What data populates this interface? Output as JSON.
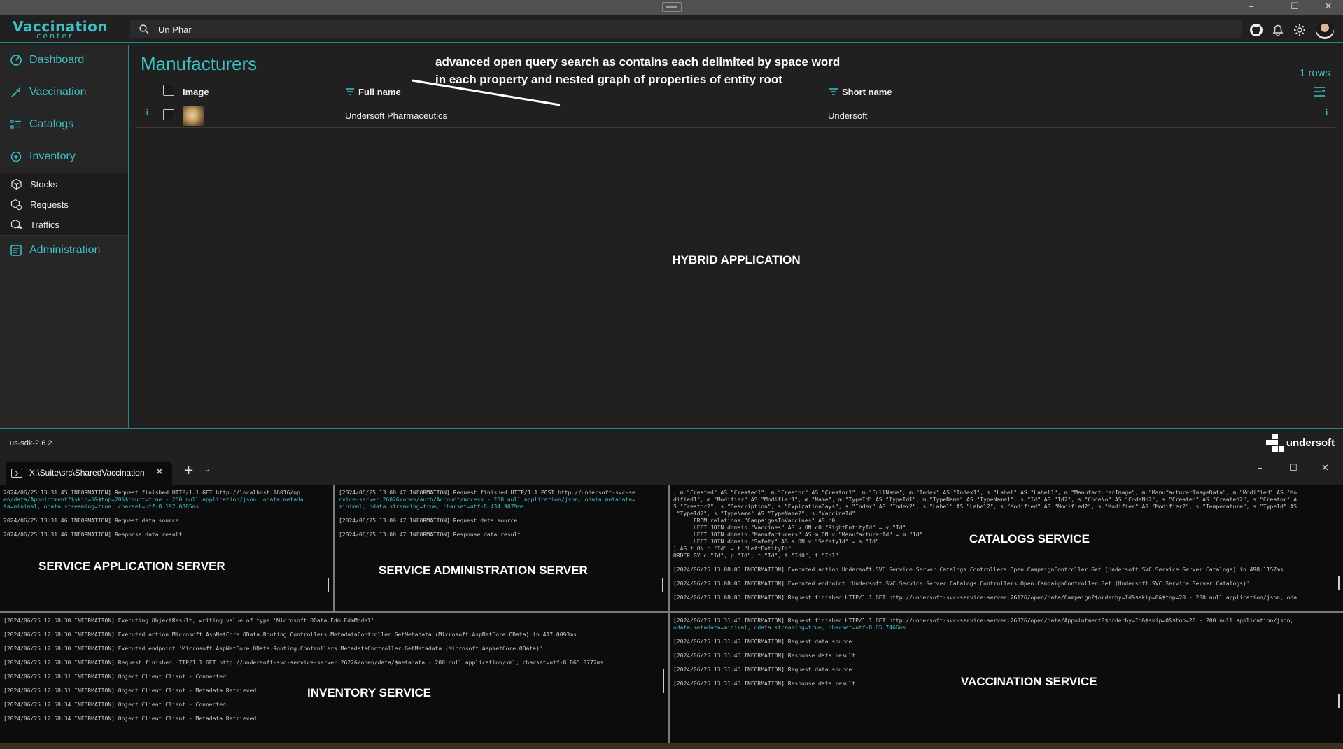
{
  "app": {
    "logo_line1": "Vaccination",
    "logo_line2": "center",
    "search_value": "Un Phar",
    "window_controls": [
      "–",
      "☐",
      "✕"
    ],
    "header_icons": [
      "github-icon",
      "bell-icon",
      "gear-icon",
      "avatar"
    ]
  },
  "sidebar": {
    "items": [
      {
        "label": "Dashboard",
        "icon": "dashboard-icon"
      },
      {
        "label": "Vaccination",
        "icon": "syringe-icon"
      },
      {
        "label": "Catalogs",
        "icon": "catalog-icon"
      },
      {
        "label": "Inventory",
        "icon": "inventory-icon"
      }
    ],
    "sub_items": [
      {
        "label": "Stocks",
        "icon": "box-icon"
      },
      {
        "label": "Requests",
        "icon": "request-icon"
      },
      {
        "label": "Traffics",
        "icon": "traffic-icon"
      }
    ],
    "admin": {
      "label": "Administration",
      "icon": "admin-icon"
    },
    "more": "..."
  },
  "main": {
    "title": "Manufacturers",
    "annotation_line1": "advanced open query search as contains each delimited by space word",
    "annotation_line2": "in each property and nested graph of properties of entity root",
    "row_count": "1 rows",
    "columns": {
      "image": "Image",
      "full_name": "Full name",
      "short_name": "Short name"
    },
    "rows": [
      {
        "full_name": "Undersoft Pharmaceutics",
        "short_name": "Undersoft"
      }
    ],
    "center_label": "HYBRID APPLICATION"
  },
  "footer": {
    "version": "us-sdk-2.6.2",
    "brand": "undersoft"
  },
  "terminal": {
    "tab_label": "X:\\Suite\\src\\SharedVaccination",
    "panes": {
      "app_server": {
        "title": "SERVICE APPLICATION SERVER",
        "lines": [
          "2024/06/25 13:31:45 INFORMATION] Request finished HTTP/1.1 GET http://localhost:16016/op",
          "en/data/Appointment?$skip=0&$top=20&$count=true - 200 null application/json; odata.metada",
          "ta=minimal; odata.streaming=true; charset=utf-8 192.0885ms",
          "2024/06/25 13:31:46 INFORMATION] Request data source",
          "2024/06/25 13:31:46 INFORMATION] Response data result"
        ]
      },
      "admin_server": {
        "title": "SERVICE ADMINISTRATION SERVER",
        "lines": [
          "[2024/06/25 13:00:47 INFORMATION] Request finished HTTP/1.1 POST http://undersoft-svc-se",
          "rvice-server:26026/open/auth/Account/Access - 200 null application/json; odata.metadata=",
          "minimal; odata.streaming=true; charset=utf-8 434.9079ms",
          "[2024/06/25 13:00:47 INFORMATION] Request data source",
          "[2024/06/25 13:00:47 INFORMATION] Response data result"
        ]
      },
      "catalogs": {
        "title": "CATALOGS SERVICE",
        "sql": [
          ", m.\"Created\" AS \"Created1\", m.\"Creator\" AS \"Creator1\", m.\"FullName\", m.\"Index\" AS \"Index1\", m.\"Label\" AS \"Label1\", m.\"ManufacturerImage\", m.\"ManufacturerImageData\", m.\"Modified\" AS \"Mo",
          "dified1\", m.\"Modifier\" AS \"Modifier1\", m.\"Name\", m.\"TypeId\" AS \"TypeId1\", m.\"TypeName\" AS \"TypeName1\", s.\"Id\" AS \"Id2\", s.\"CodeNo\" AS \"CodeNo2\", s.\"Created\" AS \"Created2\", s.\"Creator\" A",
          "S \"Creator2\", s.\"Description\", s.\"ExpirationDays\", s.\"Index\" AS \"Index2\", s.\"Label\" AS \"Label2\", s.\"Modified\" AS \"Modified2\", s.\"Modifier\" AS \"Modifier2\", s.\"Temperature\", s.\"TypeId\" AS",
          " \"TypeId2\", s.\"TypeName\" AS \"TypeName2\", s.\"VaccineId\"",
          "      FROM relations.\"CampaignsToVaccines\" AS c0",
          "      LEFT JOIN domain.\"Vaccines\" AS v ON c0.\"RightEntityId\" = v.\"Id\"",
          "      LEFT JOIN domain.\"Manufacturers\" AS m ON v.\"ManufacturerId\" = m.\"Id\"",
          "      LEFT JOIN domain.\"Safety\" AS s ON v.\"SafetyId\" = s.\"Id\"",
          ") AS t ON c.\"Id\" = t.\"LeftEntityId\"",
          "ORDER BY c.\"Id\", p.\"Id\", t.\"Id\", t.\"Id0\", t.\"Id1\""
        ],
        "lines": [
          "[2024/06/25 13:08:05 INFORMATION] Executed action Undersoft.SVC.Service.Server.Catalogs.Controllers.Open.CampaignController.Get (Undersoft.SVC.Service.Server.Catalogs) in 498.1157ms",
          "[2024/06/25 13:08:05 INFORMATION] Executed endpoint 'Undersoft.SVC.Service.Server.Catalogs.Controllers.Open.CampaignController.Get (Undersoft.SVC.Service.Server.Catalogs)'",
          "[2024/06/25 13:08:05 INFORMATION] Request finished HTTP/1.1 GET http://undersoft-svc-service-server:26126/open/data/Campaign?$orderby=Id&$skip=0&$top=20 - 200 null application/json; oda"
        ]
      },
      "inventory": {
        "title": "INVENTORY SERVICE",
        "lines": [
          "[2024/06/25 12:58:30 INFORMATION] Executing ObjectResult, writing value of type 'Microsoft.OData.Edm.EdmModel'.",
          "[2024/06/25 12:58:30 INFORMATION] Executed action Microsoft.AspNetCore.OData.Routing.Controllers.MetadataController.GetMetadata (Microsoft.AspNetCore.OData) in 417.0093ms",
          "[2024/06/25 12:58:30 INFORMATION] Executed endpoint 'Microsoft.AspNetCore.OData.Routing.Controllers.MetadataController.GetMetadata (Microsoft.AspNetCore.OData)'",
          "[2024/06/25 12:58:30 INFORMATION] Request finished HTTP/1.1 GET http://undersoft-svc-service-server:26226/open/data/$metadata - 200 null application/xml; charset=utf-8 865.0772ms",
          "[2024/06/25 12:58:31 INFORMATION] Object Client Client - Connected",
          "[2024/06/25 12:58:31 INFORMATION] Object Client Client - Metadata Retrieved",
          "[2024/06/25 12:58:34 INFORMATION] Object Client Client - Connected",
          "[2024/06/25 12:58:34 INFORMATION] Object Client Client - Metadata Retrieved"
        ]
      },
      "vaccination": {
        "title": "VACCINATION SERVICE",
        "lines": [
          "[2024/06/25 13:31:45 INFORMATION] Request finished HTTP/1.1 GET http://undersoft-svc-service-server:26326/open/data/Appointment?$orderby=Id&$skip=0&$top=20 - 200 null application/json;",
          "odata.metadata=minimal; odata.streaming=true; charset=utf-8 65.7466ms",
          "[2024/06/25 13:31:45 INFORMATION] Request data source",
          "[2024/06/25 13:31:45 INFORMATION] Response data result",
          "[2024/06/25 13:31:45 INFORMATION] Request data source",
          "[2024/06/25 13:31:45 INFORMATION] Response data result"
        ]
      }
    }
  },
  "colors": {
    "accent": "#3ec1c6",
    "background": "#202020",
    "sidebar": "#262626",
    "terminal": "#0c0c0c"
  }
}
